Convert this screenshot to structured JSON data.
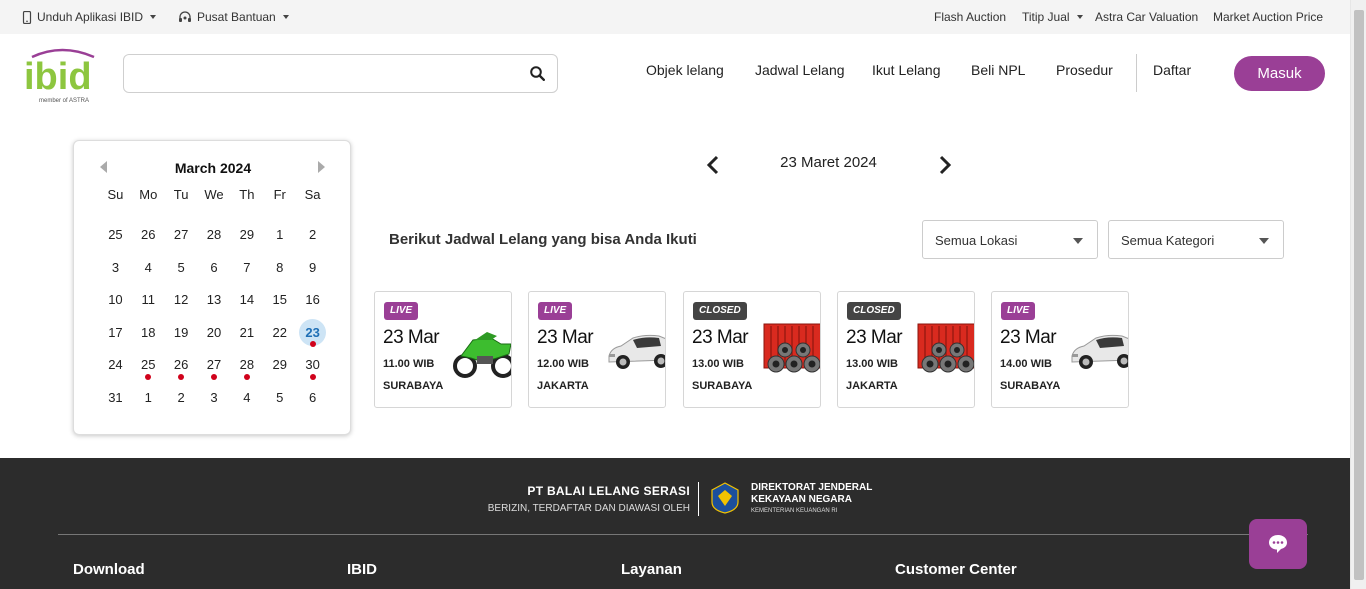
{
  "topbar": {
    "download_app": "Unduh Aplikasi IBID",
    "help_center": "Pusat Bantuan",
    "links": [
      "Flash Auction",
      "Titip Jual",
      "Astra Car Valuation",
      "Market Auction Price"
    ]
  },
  "logo": {
    "text": "ibid",
    "tagline": "member of ASTRA"
  },
  "search": {
    "placeholder": ""
  },
  "nav": {
    "items": [
      "Objek lelang",
      "Jadwal Lelang",
      "Ikut Lelang",
      "Beli NPL",
      "Prosedur"
    ],
    "register": "Daftar",
    "login": "Masuk"
  },
  "calendar": {
    "title": "March 2024",
    "weekdays": [
      "Su",
      "Mo",
      "Tu",
      "We",
      "Th",
      "Fr",
      "Sa"
    ],
    "weeks": [
      [
        "25",
        "26",
        "27",
        "28",
        "29",
        "1",
        "2"
      ],
      [
        "3",
        "4",
        "5",
        "6",
        "7",
        "8",
        "9"
      ],
      [
        "10",
        "11",
        "12",
        "13",
        "14",
        "15",
        "16"
      ],
      [
        "17",
        "18",
        "19",
        "20",
        "21",
        "22",
        "23"
      ],
      [
        "24",
        "25",
        "26",
        "27",
        "28",
        "29",
        "30"
      ],
      [
        "31",
        "1",
        "2",
        "3",
        "4",
        "5",
        "6"
      ]
    ],
    "selected": "23",
    "event_days": [
      "23",
      "25",
      "26",
      "27",
      "28",
      "30"
    ]
  },
  "date_nav": {
    "current": "23 Maret 2024"
  },
  "schedule": {
    "subtitle": "Berikut Jadwal Lelang yang bisa Anda Ikuti",
    "location_filter": "Semua Lokasi",
    "category_filter": "Semua Kategori",
    "cards": [
      {
        "status": "LIVE",
        "date": "23 Mar",
        "time": "11.00 WIB",
        "location": "SURABAYA",
        "image": "motorcycle"
      },
      {
        "status": "LIVE",
        "date": "23 Mar",
        "time": "12.00 WIB",
        "location": "JAKARTA",
        "image": "car"
      },
      {
        "status": "CLOSED",
        "date": "23 Mar",
        "time": "13.00 WIB",
        "location": "SURABAYA",
        "image": "container-pipes"
      },
      {
        "status": "CLOSED",
        "date": "23 Mar",
        "time": "13.00 WIB",
        "location": "JAKARTA",
        "image": "container-pipes"
      },
      {
        "status": "LIVE",
        "date": "23 Mar",
        "time": "14.00 WIB",
        "location": "SURABAYA",
        "image": "car"
      }
    ]
  },
  "footer": {
    "partner_name": "PT BALAI LELANG SERASI",
    "partner_sub": "BERIZIN, TERDAFTAR DAN DIAWASI OLEH",
    "regulator_line1": "DIREKTORAT JENDERAL",
    "regulator_line2": "KEKAYAAN NEGARA",
    "regulator_sub": "KEMENTERIAN KEUANGAN RI",
    "columns": [
      "Download",
      "IBID",
      "Layanan",
      "Customer Center"
    ]
  },
  "colors": {
    "brand": "#9a3f96",
    "logo_green": "#8dc63f",
    "footer_bg": "#2c2c2c",
    "event_dot": "#d0021b",
    "selected_day": "#cde4f5"
  }
}
